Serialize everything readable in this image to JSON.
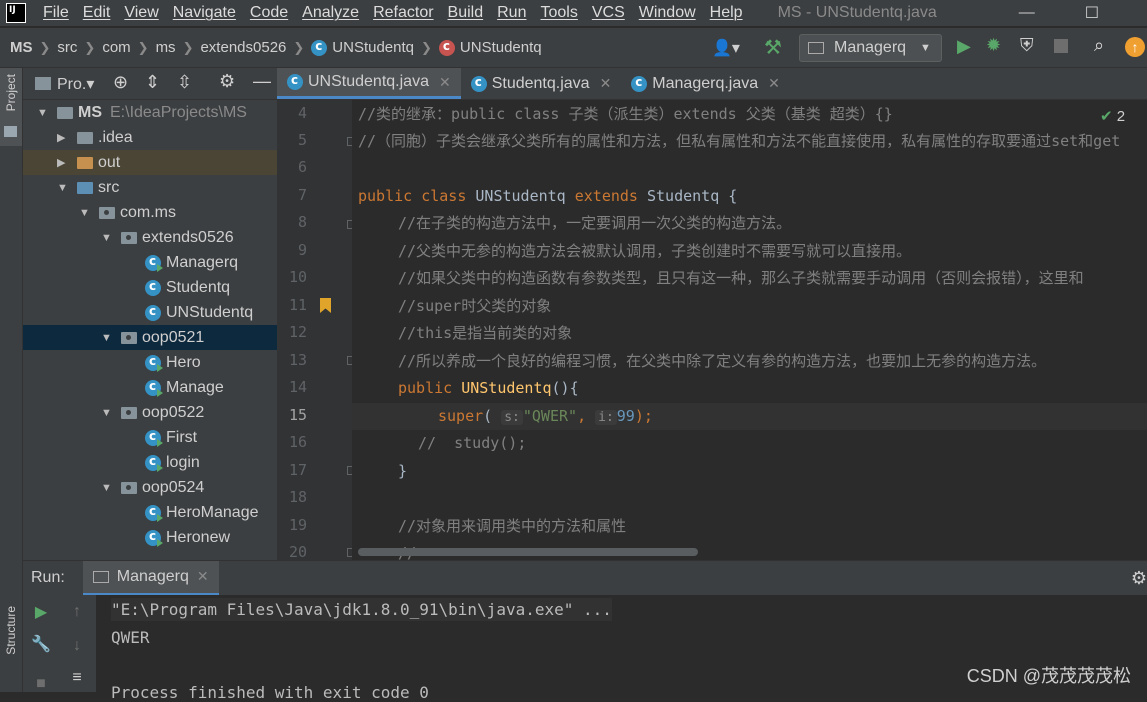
{
  "menubar": {
    "items": [
      "File",
      "Edit",
      "View",
      "Navigate",
      "Code",
      "Analyze",
      "Refactor",
      "Build",
      "Run",
      "Tools",
      "VCS",
      "Window",
      "Help"
    ],
    "window_title": "MS - UNStudentq.java"
  },
  "navbar": {
    "breadcrumbs": [
      "MS",
      "src",
      "com",
      "ms",
      "extends0526",
      "UNStudentq",
      "UNStudentq"
    ],
    "run_config": "Managerq"
  },
  "sidestrip": {
    "project_label": "Project",
    "structure_label": "Structure"
  },
  "project_panel": {
    "title": "Pro.▾",
    "root_name": "MS",
    "root_path": "E:\\IdeaProjects\\MS",
    "tree": [
      {
        "label": "MS",
        "extra": "E:\\IdeaProjects\\MS"
      },
      {
        "label": ".idea"
      },
      {
        "label": "out"
      },
      {
        "label": "src"
      },
      {
        "label": "com.ms"
      },
      {
        "label": "extends0526"
      },
      {
        "label": "Managerq"
      },
      {
        "label": "Studentq"
      },
      {
        "label": "UNStudentq"
      },
      {
        "label": "oop0521"
      },
      {
        "label": "Hero"
      },
      {
        "label": "Manage"
      },
      {
        "label": "oop0522"
      },
      {
        "label": "First"
      },
      {
        "label": "login"
      },
      {
        "label": "oop0524"
      },
      {
        "label": "HeroManage"
      },
      {
        "label": "Heronew"
      }
    ]
  },
  "tabs": [
    "UNStudentq.java",
    "Studentq.java",
    "Managerq.java"
  ],
  "editor": {
    "line_numbers": [
      "4",
      "5",
      "6",
      "7",
      "8",
      "9",
      "10",
      "11",
      "12",
      "13",
      "14",
      "15",
      "16",
      "17",
      "18",
      "19",
      "20"
    ],
    "inspection_count": "2",
    "lines": {
      "l4": "//类的继承：public class 子类（派生类）extends 父类（基类 超类）{}",
      "l5": "//（同胞）子类会继承父类所有的属性和方法，但私有属性和方法不能直接使用，私有属性的存取要通过set和get",
      "l7_kw1": "public class",
      "l7_name": "UNStudentq",
      "l7_kw2": "extends",
      "l7_rest": "Studentq {",
      "l8": "//在子类的构造方法中，一定要调用一次父类的构造方法。",
      "l9": "//父类中无参的构造方法会被默认调用，子类创建时不需要写就可以直接用。",
      "l10": "//如果父类中的构造函数有参数类型，且只有这一种，那么子类就需要手动调用（否则会报错），这里和",
      "l11": "//super时父类的对象",
      "l12": "//this是指当前类的对象",
      "l13": "//所以养成一个良好的编程习惯，在父类中除了定义有参的构造方法，也要加上无参的构造方法。",
      "l14_kw": "public",
      "l14_name": "UNStudentq",
      "l14_rest": "(){",
      "l15_kw": "super",
      "l15_hint_s": "s:",
      "l15_str": "\"QWER\"",
      "l15_hint_i": "i:",
      "l15_num": "99",
      "l15_end": ");",
      "l16": "//  study();",
      "l17": "}",
      "l19": "//对象用来调用类中的方法和属性",
      "l20": "//"
    }
  },
  "run_panel": {
    "label": "Run:",
    "tab": "Managerq",
    "output": [
      "\"E:\\Program Files\\Java\\jdk1.8.0_91\\bin\\java.exe\" ...",
      "QWER",
      "",
      "Process finished with exit code 0"
    ]
  },
  "watermark": "CSDN @茂茂茂茂松",
  "colors": {
    "keyword": "#cc7832",
    "method": "#ffc66d",
    "string": "#6a8759",
    "number": "#6897bb",
    "comment": "#808080",
    "selection": "#0d293e",
    "accent": "#4a88c7"
  }
}
